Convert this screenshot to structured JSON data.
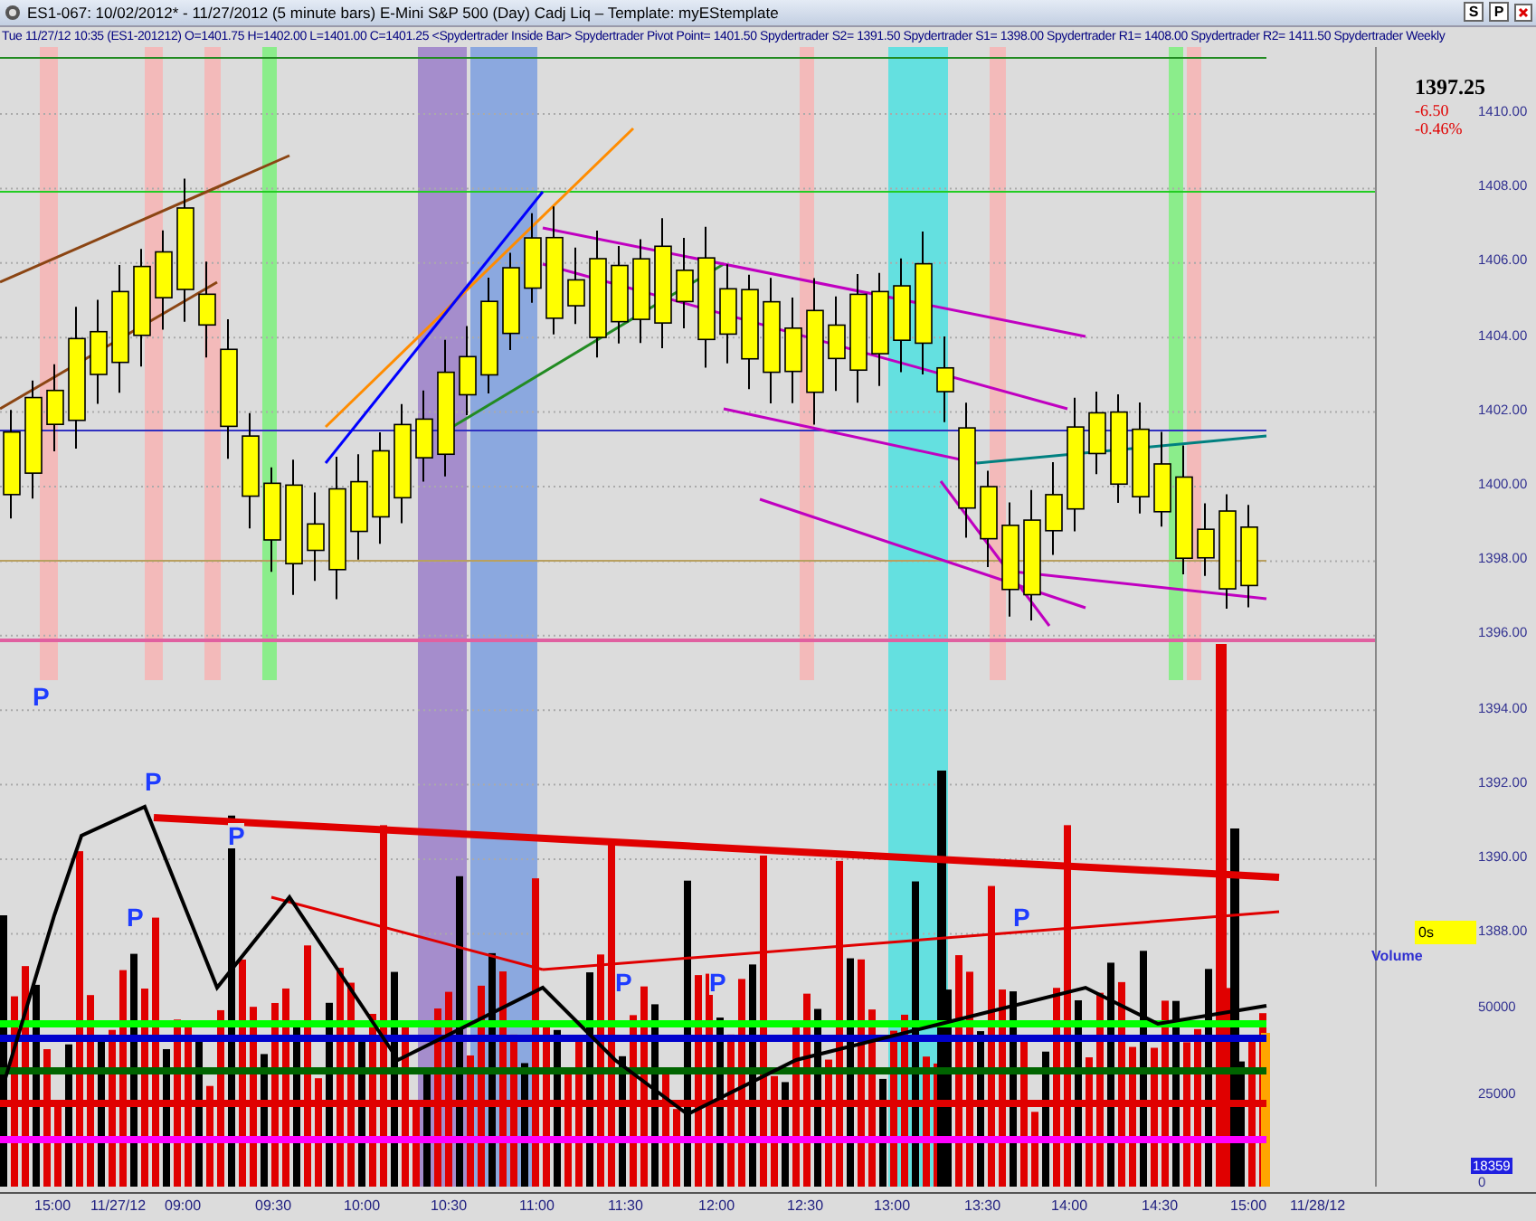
{
  "window": {
    "title": "ES1-067:  10/02/2012* - 11/27/2012  (5 minute bars)   E-Mini S&P 500 (Day) Cadj Liq  –  Template: myEStemplate",
    "buttons": [
      "S",
      "P"
    ]
  },
  "info_bar": "Tue  11/27/12 10:35 (ES1-201212)  O=1401.75  H=1402.00  L=1401.00  C=1401.25  <Spydertrader Inside Bar>  Spydertrader Pivot Point= 1401.50  Spydertrader S2= 1391.50  Spydertrader S1= 1398.00  Spydertrader R1= 1408.00  Spydertrader R2= 1411.50  Spydertrader Weekly",
  "quote": {
    "last": "1397.25",
    "change": "-6.50",
    "percent": "-0.46%"
  },
  "price_axis": [
    "1410.00",
    "1408.00",
    "1406.00",
    "1404.00",
    "1402.00",
    "1400.00",
    "1398.00",
    "1396.00",
    "1394.00",
    "1392.00",
    "1390.00",
    "1388.00"
  ],
  "volume_axis": [
    "50000",
    "25000",
    "0"
  ],
  "volume_label": "Volume",
  "timer": "0s",
  "volume_reading": "18359",
  "markers": [
    "P",
    "P",
    "P",
    "P",
    "P",
    "P",
    "P"
  ],
  "time_axis": [
    "15:00",
    "11/27/12",
    "09:00",
    "09:30",
    "10:00",
    "10:30",
    "11:00",
    "11:30",
    "12:00",
    "12:30",
    "13:00",
    "13:30",
    "14:00",
    "14:30",
    "15:00",
    "11/28/12"
  ]
}
